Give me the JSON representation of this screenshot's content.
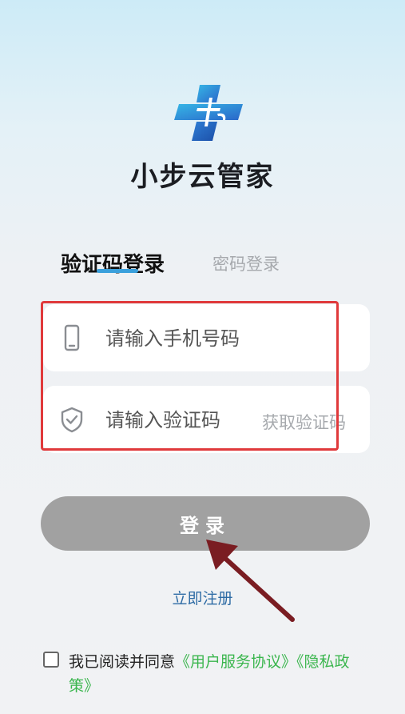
{
  "app": {
    "name": "小步云管家"
  },
  "tabs": [
    {
      "label": "验证码登录",
      "active": true
    },
    {
      "label": "密码登录",
      "active": false
    }
  ],
  "phone_field": {
    "placeholder": "请输入手机号码",
    "value": "",
    "icon": "phone-icon"
  },
  "code_field": {
    "placeholder": "请输入验证码",
    "value": "",
    "icon": "shield-check-icon",
    "get_code_label": "获取验证码"
  },
  "login_button": {
    "label": "登录"
  },
  "register_link": {
    "label": "立即注册"
  },
  "agreement": {
    "checked": false,
    "prefix": "我已阅读并同意",
    "user_agreement": "《用户服务协议》",
    "privacy_policy": "《隐私政策》"
  },
  "colors": {
    "accent": "#3aa0dc",
    "highlight_box": "#e0393b",
    "button_disabled": "#a1a1a1",
    "register_link": "#2d6ba4",
    "agreement_link": "#3bb64e",
    "annotation_arrow": "#7a1d22"
  }
}
